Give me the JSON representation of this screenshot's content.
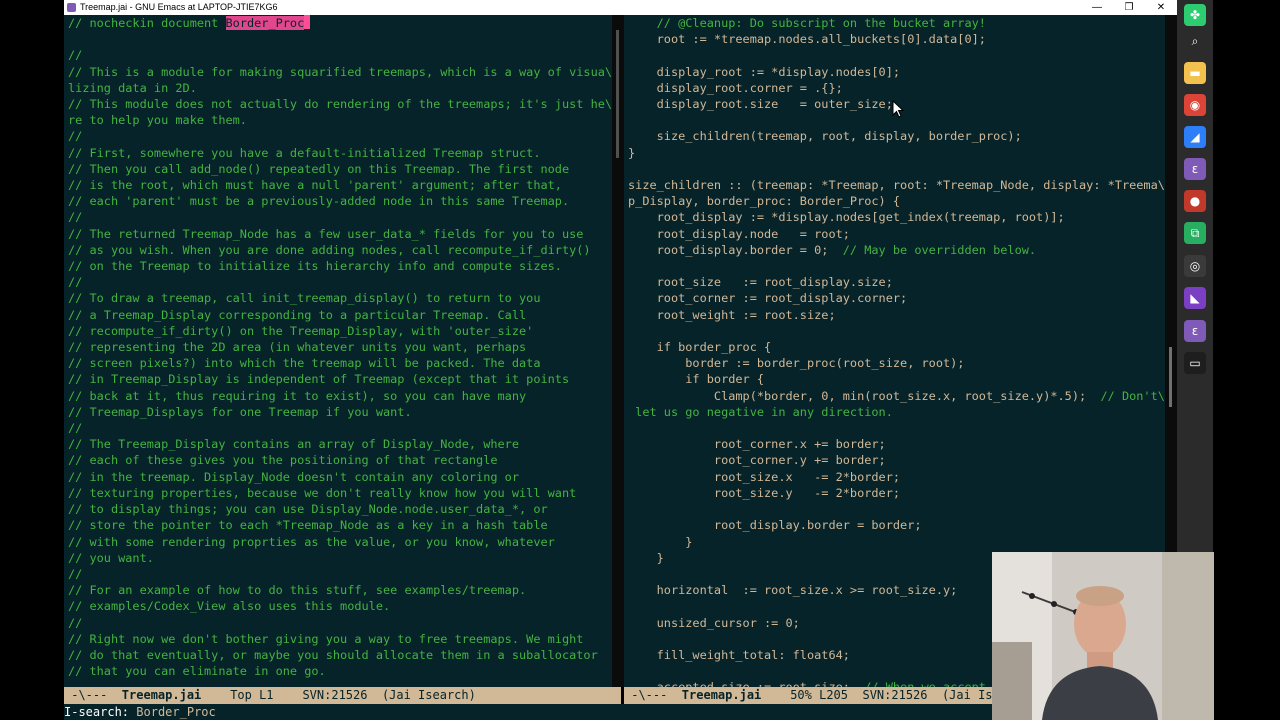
{
  "window": {
    "title": "Treemap.jai - GNU Emacs at LAPTOP-JTIE7KG6",
    "minimize_glyph": "—",
    "maximize_glyph": "❐",
    "close_glyph": "✕"
  },
  "left_pane": {
    "lines_before_match": "// nocheckin document ",
    "match_text": "Border_Proc",
    "lines": [
      "",
      "//",
      "// This is a module for making squarified treemaps, which is a way of visua\\",
      "lizing data in 2D.",
      "// This module does not actually do rendering of the treemaps; it's just he\\",
      "re to help you make them.",
      "//",
      "// First, somewhere you have a default-initialized Treemap struct.",
      "// Then you call add_node() repeatedly on this Treemap. The first node",
      "// is the root, which must have a null 'parent' argument; after that,",
      "// each 'parent' must be a previously-added node in this same Treemap.",
      "//",
      "// The returned Treemap_Node has a few user_data_* fields for you to use",
      "// as you wish. When you are done adding nodes, call recompute_if_dirty()",
      "// on the Treemap to initialize its hierarchy info and compute sizes.",
      "//",
      "// To draw a treemap, call init_treemap_display() to return to you",
      "// a Treemap_Display corresponding to a particular Treemap. Call",
      "// recompute_if_dirty() on the Treemap_Display, with 'outer_size'",
      "// representing the 2D area (in whatever units you want, perhaps",
      "// screen pixels?) into which the treemap will be packed. The data",
      "// in Treemap_Display is independent of Treemap (except that it points",
      "// back at it, thus requiring it to exist), so you can have many",
      "// Treemap_Displays for one Treemap if you want.",
      "//",
      "// The Treemap_Display contains an array of Display_Node, where",
      "// each of these gives you the positioning of that rectangle",
      "// in the treemap. Display_Node doesn't contain any coloring or",
      "// texturing properties, because we don't really know how you will want",
      "// to display things; you can use Display_Node.node.user_data_*, or",
      "// store the pointer to each *Treemap_Node as a key in a hash table",
      "// with some rendering proprties as the value, or you know, whatever",
      "// you want.",
      "//",
      "// For an example of how to do this stuff, see examples/treemap.",
      "// examples/Codex_View also uses this module.",
      "//",
      "// Right now we don't bother giving you a way to free treemaps. We might",
      "// do that eventually, or maybe you should allocate them in a suballocator",
      "// that you can eliminate in one go."
    ]
  },
  "right_pane": {
    "lines": [
      "    // @Cleanup: Do subscript on the bucket array!",
      "    root := *treemap.nodes.all_buckets[0].data[0];",
      "",
      "    display_root := *display.nodes[0];",
      "    display_root.corner = .{};",
      "    display_root.size   = outer_size;",
      "",
      "    size_children(treemap, root, display, border_proc);",
      "}",
      "",
      "size_children :: (treemap: *Treemap, root: *Treemap_Node, display: *Treema\\",
      "p_Display, border_proc: Border_Proc) {",
      "    root_display := *display.nodes[get_index(treemap, root)];",
      "    root_display.node   = root;",
      "    root_display.border = 0;  // May be overridden below.",
      "",
      "    root_size   := root_display.size;",
      "    root_corner := root_display.corner;",
      "    root_weight := root.size;",
      "",
      "    if border_proc {",
      "        border := border_proc(root_size, root);",
      "        if border {",
      "            Clamp(*border, 0, min(root_size.x, root_size.y)*.5);  // Don't\\",
      " let us go negative in any direction.",
      "",
      "            root_corner.x += border;",
      "            root_corner.y += border;",
      "            root_size.x   -= 2*border;",
      "            root_size.y   -= 2*border;",
      "",
      "            root_display.border = border;",
      "        }",
      "    }",
      "",
      "    horizontal  := root_size.x >= root_size.y;",
      "",
      "    unsized_cursor := 0;",
      "",
      "    fill_weight_total: float64;",
      "",
      "    accepted_size := root_size;  // When we accept"
    ]
  },
  "modeline_left": {
    "prefix": " -\\---  ",
    "buffer": "Treemap.jai",
    "position": "Top L1",
    "vcs": "SVN:21526",
    "mode": "(Jai Isearch)"
  },
  "modeline_right": {
    "prefix": " -\\---  ",
    "buffer": "Treemap.jai",
    "percent": "50%",
    "line": "L205",
    "vcs": "SVN:21526",
    "mode": "(Jai Is"
  },
  "echo_area": {
    "prompt": "I-search:",
    "query": "Border_Proc"
  },
  "taskbar": [
    {
      "name": "cluster-app-icon",
      "color": "#2ecc71",
      "glyph": "✤"
    },
    {
      "name": "search-icon",
      "color": "#2b2b2b",
      "glyph": "⌕"
    },
    {
      "name": "file-explorer-icon",
      "color": "#f2c14e",
      "glyph": "▬"
    },
    {
      "name": "chrome-icon",
      "color": "#db4437",
      "glyph": "◉"
    },
    {
      "name": "visual-studio-icon",
      "color": "#2d7ff9",
      "glyph": "◢"
    },
    {
      "name": "emacs-icon",
      "color": "#7f5ab6",
      "glyph": "ε"
    },
    {
      "name": "recorder-icon",
      "color": "#c0392b",
      "glyph": "●"
    },
    {
      "name": "remote-app-icon",
      "color": "#27ae60",
      "glyph": "⧉"
    },
    {
      "name": "obs-icon",
      "color": "#3a3a3a",
      "glyph": "◎"
    },
    {
      "name": "vs-purple-icon",
      "color": "#7b3fc4",
      "glyph": "◣"
    },
    {
      "name": "emacs-icon-2",
      "color": "#7f5ab6",
      "glyph": "ε"
    },
    {
      "name": "terminal-icon",
      "color": "#1e1e1e",
      "glyph": "▭"
    }
  ]
}
